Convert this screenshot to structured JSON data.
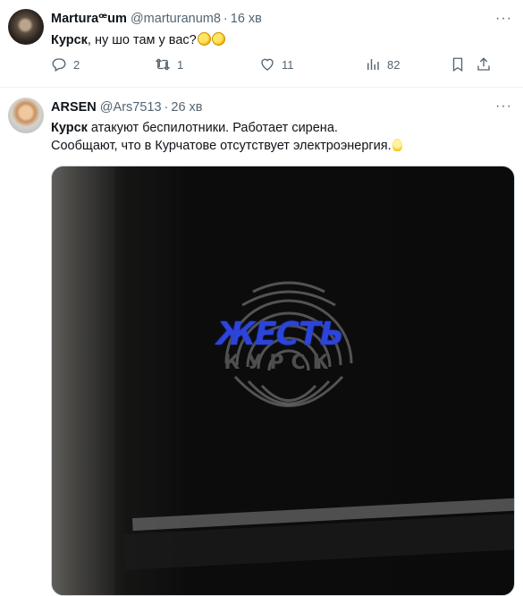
{
  "tweets": [
    {
      "name": "Marturaꟹum",
      "handle": "@marturanum8",
      "time": "16 хв",
      "text_bold": "Курск",
      "text_rest": ", ну шо там у вас?",
      "emojis": [
        "face-with-monocle",
        "face-with-monocle"
      ],
      "actions": {
        "replies": "2",
        "reposts": "1",
        "likes": "11",
        "views": "82"
      }
    },
    {
      "name": "ARSEN",
      "handle": "@Ars7513",
      "time": "26 хв",
      "text_bold": "Курск",
      "text_line1_rest": " атакуют беспилотники. Работает сирена.",
      "text_line2": "Сообщают, что в Курчатове отсутствует электроэнергия.",
      "emojis": [
        "light-bulb"
      ],
      "media": {
        "watermark_title": "ЖЕСТЬ",
        "watermark_subtitle": "КУРСК"
      }
    }
  ],
  "colors": {
    "text": "#0f1419",
    "secondary": "#536471",
    "divider": "#eff3f4",
    "watermark_blue": "#2c44d8"
  },
  "icons": [
    "more-icon",
    "reply-icon",
    "repost-icon",
    "like-icon",
    "views-icon",
    "bookmark-icon",
    "share-icon"
  ]
}
